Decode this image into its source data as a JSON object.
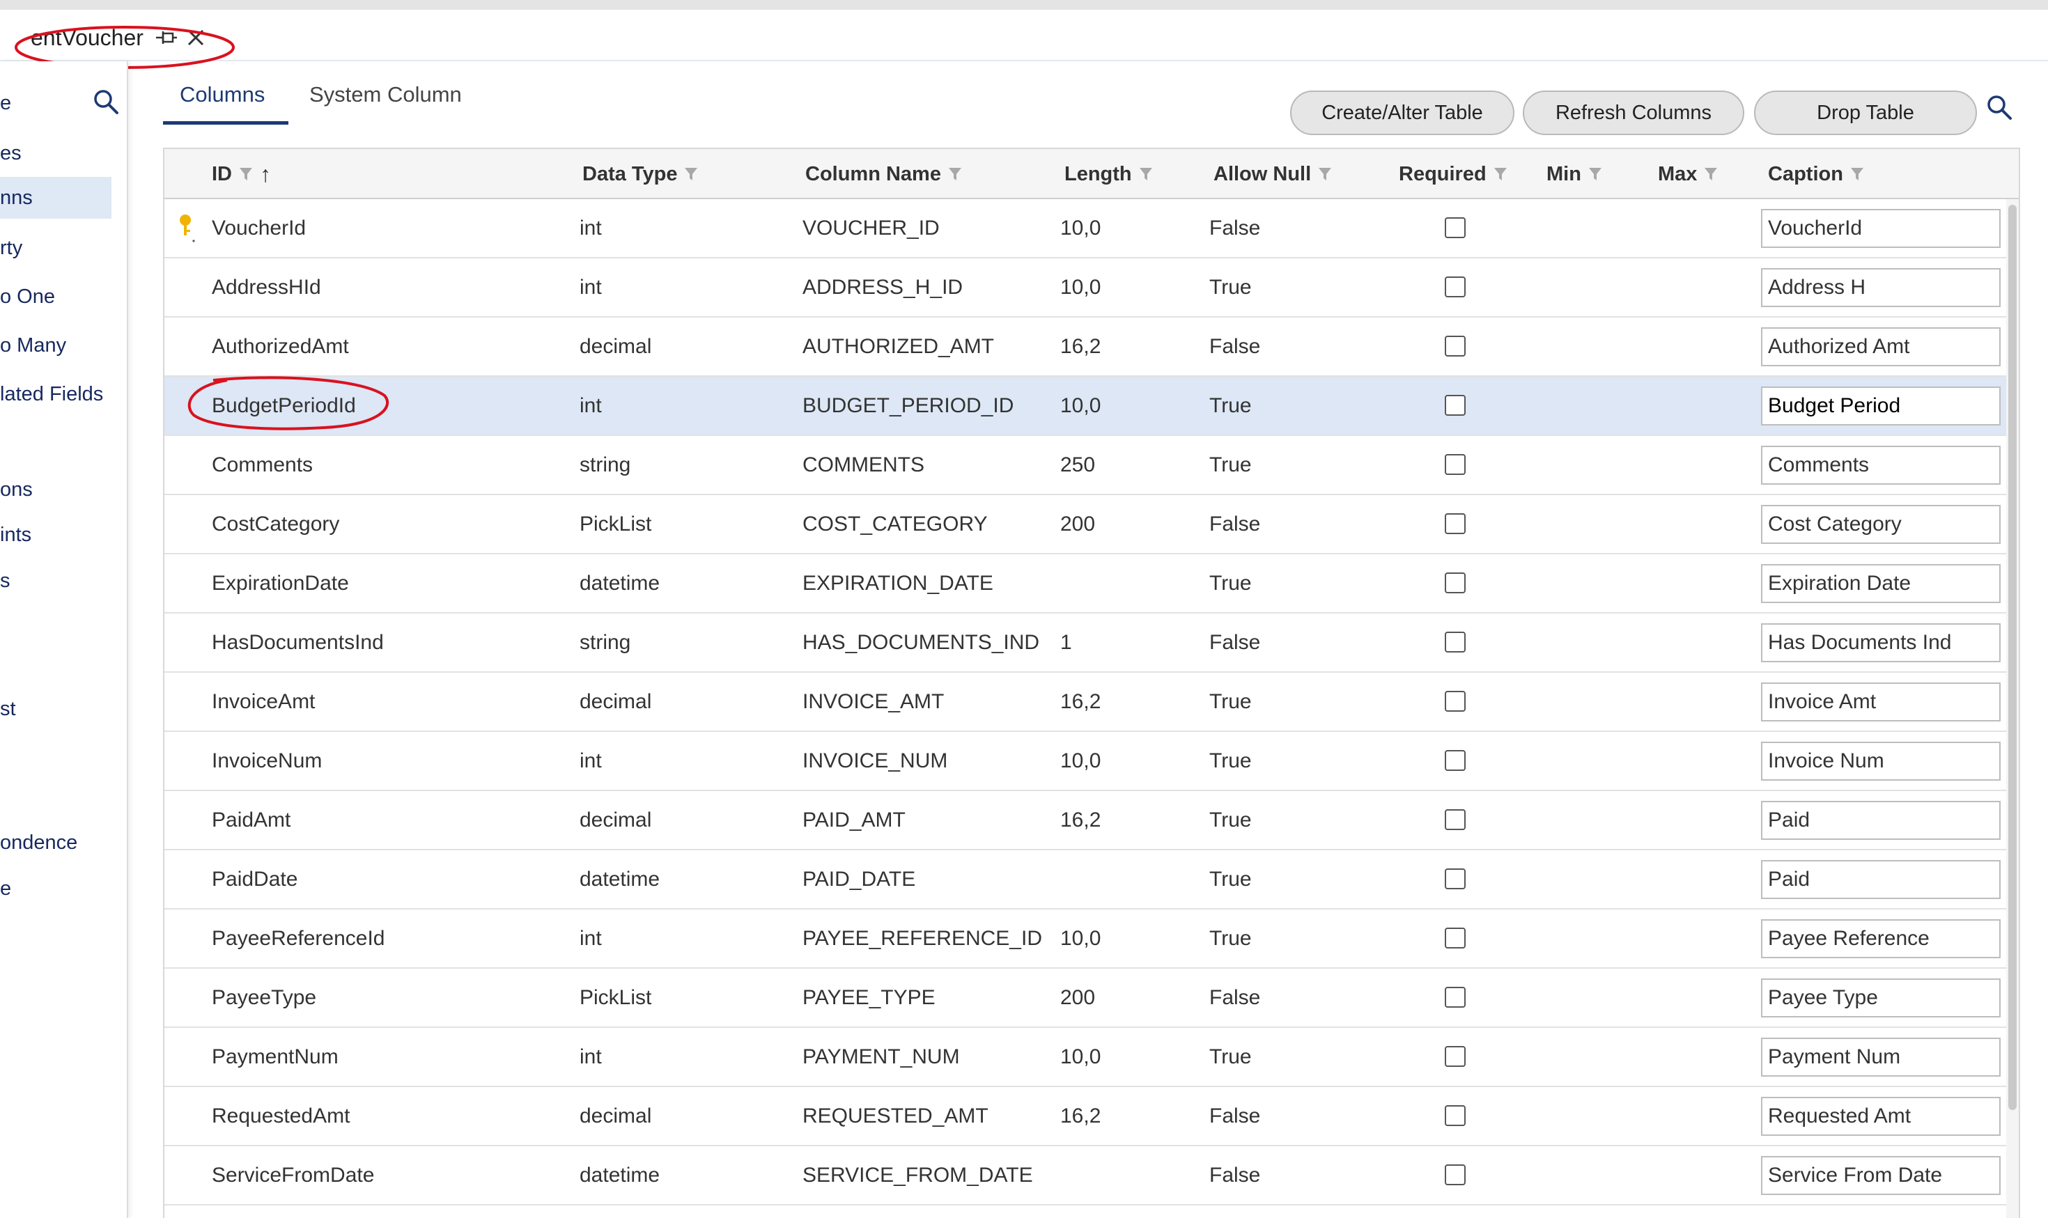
{
  "document_tab": {
    "title": "entVoucher"
  },
  "sidebar": {
    "items": [
      {
        "label": "e"
      },
      {
        "label": "es"
      },
      {
        "label": "nns"
      },
      {
        "label": "rty"
      },
      {
        "label": "o One"
      },
      {
        "label": "o Many"
      },
      {
        "label": "lated Fields"
      },
      {
        "label": "ons"
      },
      {
        "label": "ints"
      },
      {
        "label": "s"
      },
      {
        "label": "st"
      },
      {
        "label": "ondence"
      },
      {
        "label": "e"
      }
    ]
  },
  "view_tabs": {
    "columns": "Columns",
    "system_column": "System Column"
  },
  "toolbar": {
    "create_alter": "Create/Alter Table",
    "refresh": "Refresh Columns",
    "drop": "Drop Table"
  },
  "grid": {
    "headers": {
      "id": "ID",
      "sort_indicator": "↑",
      "data_type": "Data Type",
      "column_name": "Column Name",
      "length": "Length",
      "allow_null": "Allow Null",
      "required": "Required",
      "min": "Min",
      "max": "Max",
      "caption": "Caption"
    },
    "rows": [
      {
        "id": "VoucherId",
        "type": "int",
        "column": "VOUCHER_ID",
        "length": "10,0",
        "allow_null": "False",
        "caption": "VoucherId"
      },
      {
        "id": "AddressHId",
        "type": "int",
        "column": "ADDRESS_H_ID",
        "length": "10,0",
        "allow_null": "True",
        "caption": "Address H"
      },
      {
        "id": "AuthorizedAmt",
        "type": "decimal",
        "column": "AUTHORIZED_AMT",
        "length": "16,2",
        "allow_null": "False",
        "caption": "Authorized Amt"
      },
      {
        "id": "BudgetPeriodId",
        "type": "int",
        "column": "BUDGET_PERIOD_ID",
        "length": "10,0",
        "allow_null": "True",
        "caption": "Budget Period"
      },
      {
        "id": "Comments",
        "type": "string",
        "column": "COMMENTS",
        "length": "250",
        "allow_null": "True",
        "caption": "Comments"
      },
      {
        "id": "CostCategory",
        "type": "PickList",
        "column": "COST_CATEGORY",
        "length": "200",
        "allow_null": "False",
        "caption": "Cost Category"
      },
      {
        "id": "ExpirationDate",
        "type": "datetime",
        "column": "EXPIRATION_DATE",
        "length": "",
        "allow_null": "True",
        "caption": "Expiration Date"
      },
      {
        "id": "HasDocumentsInd",
        "type": "string",
        "column": "HAS_DOCUMENTS_IND",
        "length": "1",
        "allow_null": "False",
        "caption": "Has Documents Ind"
      },
      {
        "id": "InvoiceAmt",
        "type": "decimal",
        "column": "INVOICE_AMT",
        "length": "16,2",
        "allow_null": "True",
        "caption": "Invoice Amt"
      },
      {
        "id": "InvoiceNum",
        "type": "int",
        "column": "INVOICE_NUM",
        "length": "10,0",
        "allow_null": "True",
        "caption": "Invoice Num"
      },
      {
        "id": "PaidAmt",
        "type": "decimal",
        "column": "PAID_AMT",
        "length": "16,2",
        "allow_null": "True",
        "caption": "Paid"
      },
      {
        "id": "PaidDate",
        "type": "datetime",
        "column": "PAID_DATE",
        "length": "",
        "allow_null": "True",
        "caption": "Paid"
      },
      {
        "id": "PayeeReferenceId",
        "type": "int",
        "column": "PAYEE_REFERENCE_ID",
        "length": "10,0",
        "allow_null": "True",
        "caption": "Payee Reference"
      },
      {
        "id": "PayeeType",
        "type": "PickList",
        "column": "PAYEE_TYPE",
        "length": "200",
        "allow_null": "False",
        "caption": "Payee Type"
      },
      {
        "id": "PaymentNum",
        "type": "int",
        "column": "PAYMENT_NUM",
        "length": "10,0",
        "allow_null": "True",
        "caption": "Payment Num"
      },
      {
        "id": "RequestedAmt",
        "type": "decimal",
        "column": "REQUESTED_AMT",
        "length": "16,2",
        "allow_null": "False",
        "caption": "Requested Amt"
      },
      {
        "id": "ServiceFromDate",
        "type": "datetime",
        "column": "SERVICE_FROM_DATE",
        "length": "",
        "allow_null": "False",
        "caption": "Service From Date"
      }
    ]
  },
  "colors": {
    "accent": "#1d3a73",
    "selected_row": "#dde7f5",
    "annotation": "#d9121f",
    "key_icon": "#f0b400"
  }
}
